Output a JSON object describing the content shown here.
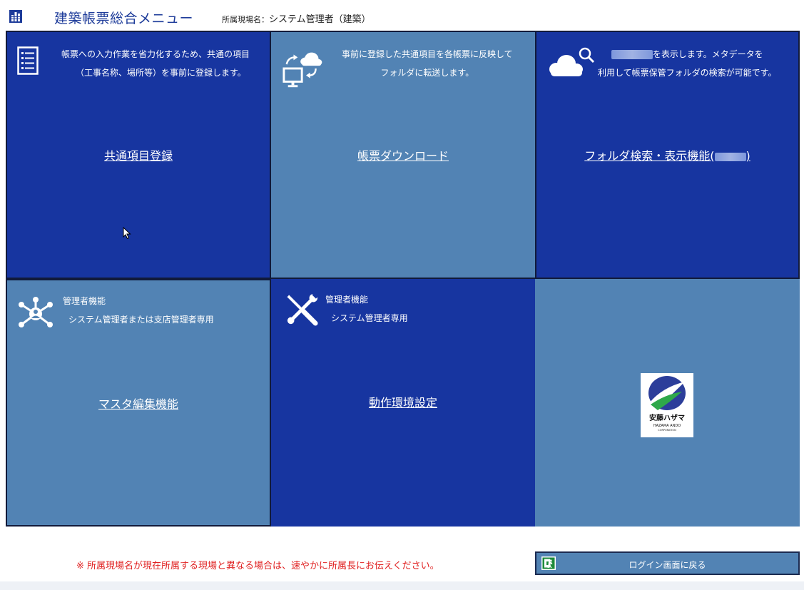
{
  "header": {
    "title": "建築帳票総合メニュー",
    "user_label": "所属現場名：",
    "user_value": "システム管理者（建築）"
  },
  "tiles": [
    {
      "id": "common-items",
      "icon": "list-document-icon",
      "desc_lines": [
        "帳票への入力作業を省力化するため、共通の項目",
        "（工事名称、場所等）を事前に登録します。"
      ],
      "link": "共通項目登録",
      "color": "#1735a0"
    },
    {
      "id": "form-download",
      "icon": "cloud-sync-monitor-icon",
      "desc_lines": [
        "事前に登録した共通項目を各帳票に反映して",
        "フォルダに転送します。"
      ],
      "link": "帳票ダウンロード",
      "color": "#5283b4"
    },
    {
      "id": "folder-search",
      "icon": "cloud-search-icon",
      "desc_line1_suffix": "を表示します。メタデータを",
      "desc_line2": "利用して帳票保管フォルダの検索が可能です。",
      "link_prefix": "フォルダ検索・表示機能(",
      "link_suffix": ")",
      "color": "#1735a0"
    },
    {
      "id": "master-edit",
      "icon": "network-hub-icon",
      "desc_title": "管理者機能",
      "desc_sub": "システム管理者または支店管理者専用",
      "link": "マスタ編集機能",
      "color": "#5283b4"
    },
    {
      "id": "env-settings",
      "icon": "tools-icon",
      "desc_title": "管理者機能",
      "desc_sub": "システム管理者専用",
      "link": "動作環境設定",
      "color": "#1735a0"
    },
    {
      "id": "company-logo",
      "icon": "hazama-ando-logo",
      "logo_text": "安藤ハザマ",
      "logo_sub": "HAZAMA ANDO",
      "logo_sub2": "CORPORATION",
      "color": "#5283b4"
    }
  ],
  "footer": {
    "notice": "※ 所属現場名が現在所属する現場と異なる場合は、速やかに所属長にお伝えください。",
    "back_button": "ログイン画面に戻る",
    "back_icon": "exit-icon"
  }
}
